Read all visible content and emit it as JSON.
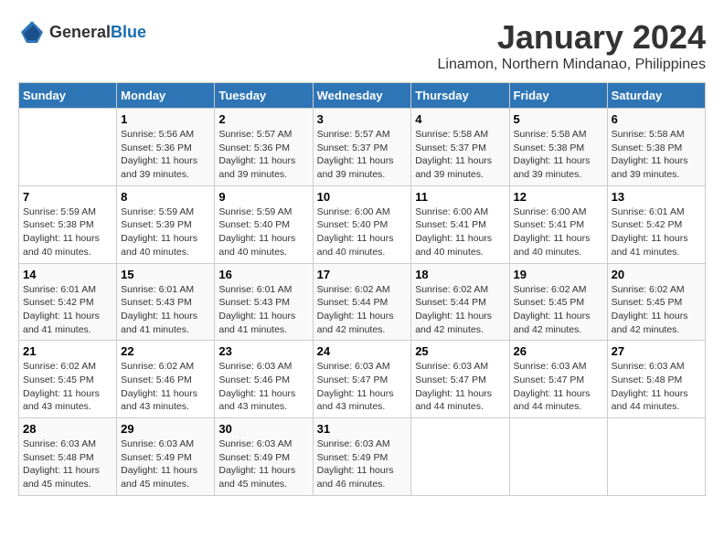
{
  "header": {
    "logo_general": "General",
    "logo_blue": "Blue",
    "month_title": "January 2024",
    "location": "Linamon, Northern Mindanao, Philippines"
  },
  "days_of_week": [
    "Sunday",
    "Monday",
    "Tuesday",
    "Wednesday",
    "Thursday",
    "Friday",
    "Saturday"
  ],
  "weeks": [
    [
      {
        "day": "",
        "info": ""
      },
      {
        "day": "1",
        "info": "Sunrise: 5:56 AM\nSunset: 5:36 PM\nDaylight: 11 hours\nand 39 minutes."
      },
      {
        "day": "2",
        "info": "Sunrise: 5:57 AM\nSunset: 5:36 PM\nDaylight: 11 hours\nand 39 minutes."
      },
      {
        "day": "3",
        "info": "Sunrise: 5:57 AM\nSunset: 5:37 PM\nDaylight: 11 hours\nand 39 minutes."
      },
      {
        "day": "4",
        "info": "Sunrise: 5:58 AM\nSunset: 5:37 PM\nDaylight: 11 hours\nand 39 minutes."
      },
      {
        "day": "5",
        "info": "Sunrise: 5:58 AM\nSunset: 5:38 PM\nDaylight: 11 hours\nand 39 minutes."
      },
      {
        "day": "6",
        "info": "Sunrise: 5:58 AM\nSunset: 5:38 PM\nDaylight: 11 hours\nand 39 minutes."
      }
    ],
    [
      {
        "day": "7",
        "info": "Sunrise: 5:59 AM\nSunset: 5:38 PM\nDaylight: 11 hours\nand 40 minutes."
      },
      {
        "day": "8",
        "info": "Sunrise: 5:59 AM\nSunset: 5:39 PM\nDaylight: 11 hours\nand 40 minutes."
      },
      {
        "day": "9",
        "info": "Sunrise: 5:59 AM\nSunset: 5:40 PM\nDaylight: 11 hours\nand 40 minutes."
      },
      {
        "day": "10",
        "info": "Sunrise: 6:00 AM\nSunset: 5:40 PM\nDaylight: 11 hours\nand 40 minutes."
      },
      {
        "day": "11",
        "info": "Sunrise: 6:00 AM\nSunset: 5:41 PM\nDaylight: 11 hours\nand 40 minutes."
      },
      {
        "day": "12",
        "info": "Sunrise: 6:00 AM\nSunset: 5:41 PM\nDaylight: 11 hours\nand 40 minutes."
      },
      {
        "day": "13",
        "info": "Sunrise: 6:01 AM\nSunset: 5:42 PM\nDaylight: 11 hours\nand 41 minutes."
      }
    ],
    [
      {
        "day": "14",
        "info": "Sunrise: 6:01 AM\nSunset: 5:42 PM\nDaylight: 11 hours\nand 41 minutes."
      },
      {
        "day": "15",
        "info": "Sunrise: 6:01 AM\nSunset: 5:43 PM\nDaylight: 11 hours\nand 41 minutes."
      },
      {
        "day": "16",
        "info": "Sunrise: 6:01 AM\nSunset: 5:43 PM\nDaylight: 11 hours\nand 41 minutes."
      },
      {
        "day": "17",
        "info": "Sunrise: 6:02 AM\nSunset: 5:44 PM\nDaylight: 11 hours\nand 42 minutes."
      },
      {
        "day": "18",
        "info": "Sunrise: 6:02 AM\nSunset: 5:44 PM\nDaylight: 11 hours\nand 42 minutes."
      },
      {
        "day": "19",
        "info": "Sunrise: 6:02 AM\nSunset: 5:45 PM\nDaylight: 11 hours\nand 42 minutes."
      },
      {
        "day": "20",
        "info": "Sunrise: 6:02 AM\nSunset: 5:45 PM\nDaylight: 11 hours\nand 42 minutes."
      }
    ],
    [
      {
        "day": "21",
        "info": "Sunrise: 6:02 AM\nSunset: 5:45 PM\nDaylight: 11 hours\nand 43 minutes."
      },
      {
        "day": "22",
        "info": "Sunrise: 6:02 AM\nSunset: 5:46 PM\nDaylight: 11 hours\nand 43 minutes."
      },
      {
        "day": "23",
        "info": "Sunrise: 6:03 AM\nSunset: 5:46 PM\nDaylight: 11 hours\nand 43 minutes."
      },
      {
        "day": "24",
        "info": "Sunrise: 6:03 AM\nSunset: 5:47 PM\nDaylight: 11 hours\nand 43 minutes."
      },
      {
        "day": "25",
        "info": "Sunrise: 6:03 AM\nSunset: 5:47 PM\nDaylight: 11 hours\nand 44 minutes."
      },
      {
        "day": "26",
        "info": "Sunrise: 6:03 AM\nSunset: 5:47 PM\nDaylight: 11 hours\nand 44 minutes."
      },
      {
        "day": "27",
        "info": "Sunrise: 6:03 AM\nSunset: 5:48 PM\nDaylight: 11 hours\nand 44 minutes."
      }
    ],
    [
      {
        "day": "28",
        "info": "Sunrise: 6:03 AM\nSunset: 5:48 PM\nDaylight: 11 hours\nand 45 minutes."
      },
      {
        "day": "29",
        "info": "Sunrise: 6:03 AM\nSunset: 5:49 PM\nDaylight: 11 hours\nand 45 minutes."
      },
      {
        "day": "30",
        "info": "Sunrise: 6:03 AM\nSunset: 5:49 PM\nDaylight: 11 hours\nand 45 minutes."
      },
      {
        "day": "31",
        "info": "Sunrise: 6:03 AM\nSunset: 5:49 PM\nDaylight: 11 hours\nand 46 minutes."
      },
      {
        "day": "",
        "info": ""
      },
      {
        "day": "",
        "info": ""
      },
      {
        "day": "",
        "info": ""
      }
    ]
  ]
}
